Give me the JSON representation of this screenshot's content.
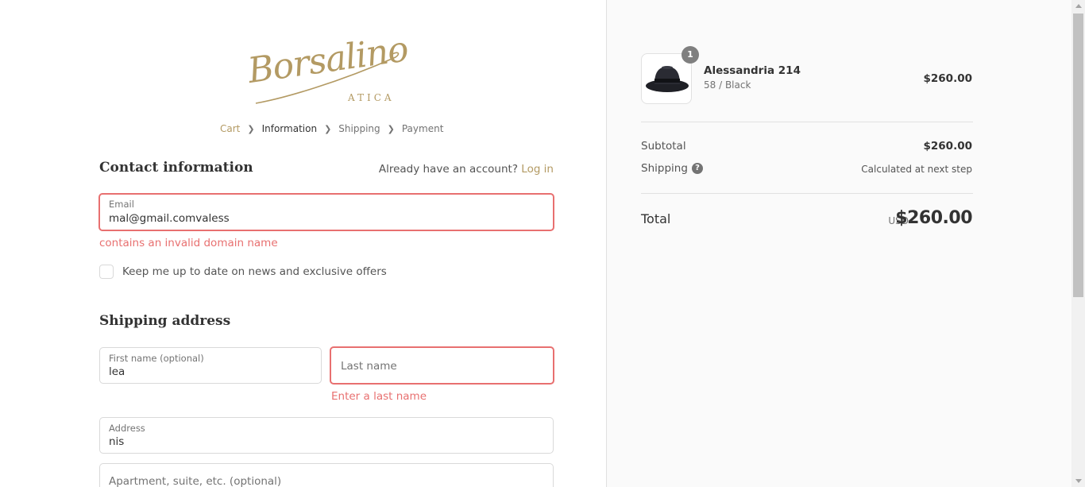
{
  "brand": {
    "logo_script": "Borsalino",
    "logo_sub": "ATICA"
  },
  "breadcrumb": {
    "items": [
      {
        "label": "Cart",
        "state": "link"
      },
      {
        "label": "Information",
        "state": "current"
      },
      {
        "label": "Shipping",
        "state": "next"
      },
      {
        "label": "Payment",
        "state": "next"
      }
    ]
  },
  "contact": {
    "title": "Contact information",
    "account_prompt": "Already have an account?",
    "login_link": "Log in",
    "email_label": "Email",
    "email_value": "mal@gmail.comvaless",
    "email_error": "contains an invalid domain name",
    "newsletter_label": "Keep me up to date on news and exclusive offers"
  },
  "shipping": {
    "title": "Shipping address",
    "first_name_label": "First name (optional)",
    "first_name_value": "lea",
    "last_name_placeholder": "Last name",
    "last_name_error": "Enter a last name",
    "address_label": "Address",
    "address_value": "nis",
    "apartment_placeholder": "Apartment, suite, etc. (optional)"
  },
  "order": {
    "item": {
      "quantity": "1",
      "name": "Alessandria 214",
      "variant": "58 / Black",
      "price": "$260.00"
    },
    "subtotal_label": "Subtotal",
    "subtotal_value": "$260.00",
    "shipping_label": "Shipping",
    "shipping_help_icon": "?",
    "shipping_value": "Calculated at next step",
    "total_label": "Total",
    "total_currency": "USD",
    "total_value": "$260.00"
  },
  "colors": {
    "accent": "#b39a63",
    "error": "#e87070",
    "sidebar_bg": "#fafafa"
  }
}
